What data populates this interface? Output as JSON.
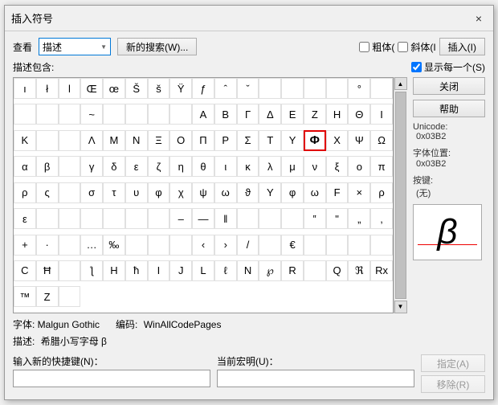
{
  "dialog": {
    "title": "插入符号",
    "close_label": "×"
  },
  "toolbar": {
    "search_label": "查看",
    "search_type_label": "描述",
    "new_search_label": "新的搜索(W)...",
    "checkbox_bold_label": "粗体(",
    "checkbox_italic_label": "斜体(I",
    "show_each_label": "显示每一个(S)",
    "insert_label": "插入(I)"
  },
  "sidebar": {
    "close_label": "关闭",
    "help_label": "帮助",
    "unicode_label": "Unicode:",
    "unicode_value": "0x03B2",
    "position_label": "字体位置:",
    "position_value": "0x03B2",
    "key_label": "按键:",
    "key_value": "(无)",
    "preview_char": "β"
  },
  "bottom": {
    "font_label": "字体: Malgun Gothic",
    "encoding_label": "编码:",
    "encoding_value": "WinAllCodePages",
    "desc_label": "描述:",
    "desc_value": "希腊小写字母 β",
    "shortcut_label": "输入新的快捷键(N)：",
    "current_shortcut_label": "当前宏明(U)：",
    "assign_label": "指定(A)",
    "remove_label": "移除(R)"
  },
  "symbols": [
    "ı",
    "ł",
    "l",
    "Œ",
    "œ",
    "Š",
    "š",
    "Ÿ",
    "ƒ",
    "ˆ",
    "ˇ",
    "",
    "",
    "",
    "",
    "°",
    "",
    "",
    "",
    "",
    "~",
    "",
    "",
    "",
    "",
    "A",
    "B",
    "Γ",
    "Δ",
    "E",
    "Z",
    "H",
    "Θ",
    "I",
    "K",
    "",
    "",
    "Λ",
    "M",
    "N",
    "Ξ",
    "O",
    "Π",
    "Ρ",
    "Σ",
    "T",
    "Υ",
    "Φ",
    "X",
    "Ψ",
    "Ω",
    "α",
    "β",
    "",
    "γ",
    "δ",
    "ε",
    "ζ",
    "η",
    "θ",
    "ι",
    "κ",
    "λ",
    "μ",
    "ν",
    "ξ",
    "ο",
    "π",
    "ρ",
    "ς",
    "",
    "σ",
    "τ",
    "υ",
    "φ",
    "χ",
    "ψ",
    "ω",
    "ϑ",
    "Υ",
    "φ",
    "ω",
    "F",
    "×",
    "ρ",
    "ε",
    "",
    "",
    "",
    "",
    "",
    "",
    "–",
    "—",
    "‖",
    "",
    "",
    "",
    "‟",
    "\"",
    "„",
    ",",
    "+",
    "·",
    "",
    "…",
    "‰",
    "",
    "",
    "",
    "‹",
    "›",
    "/",
    "",
    "€",
    "",
    "",
    "",
    "",
    "С",
    "Ħ",
    "",
    "ƪ",
    "H",
    "ħ",
    "I",
    "J",
    "L",
    "ℓ",
    "N",
    "℘",
    "R",
    "",
    "Q",
    "ℜ",
    "Rx",
    "™",
    "Z",
    ""
  ],
  "selected_index": 47
}
